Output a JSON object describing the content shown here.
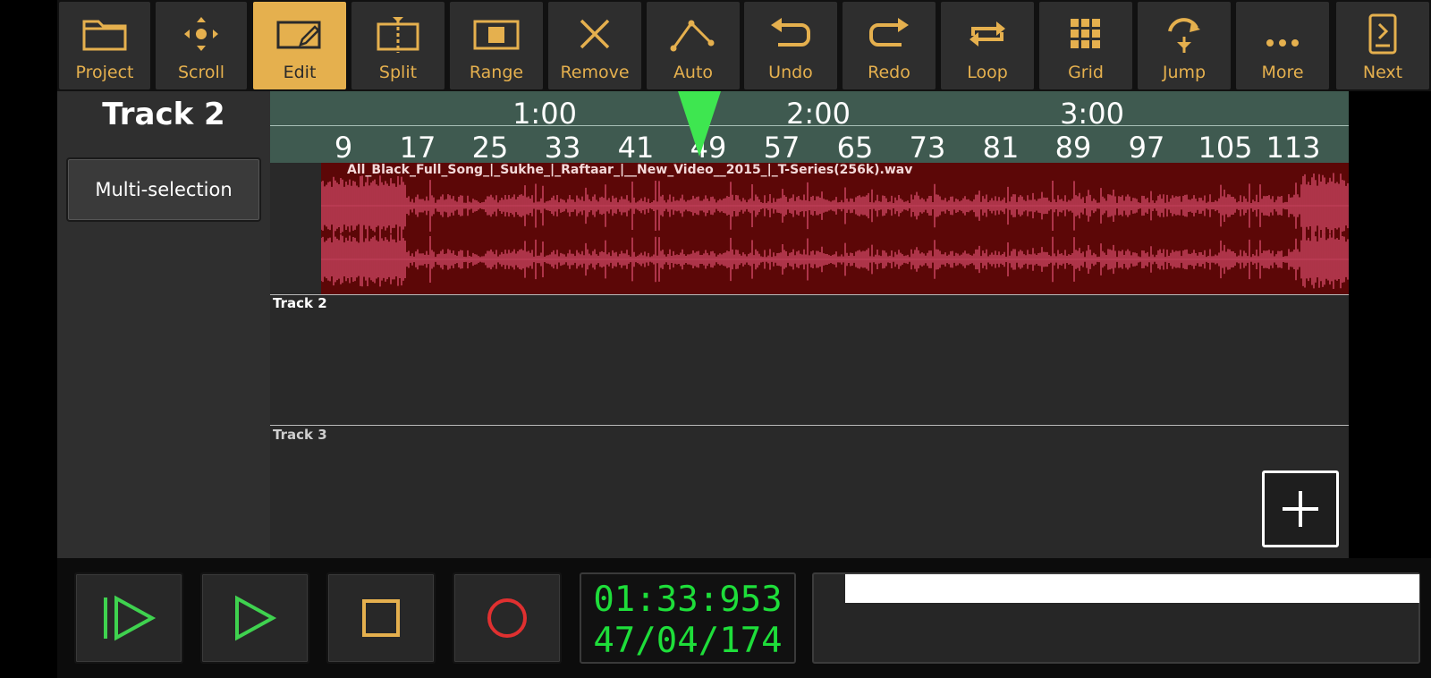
{
  "toolbar": {
    "project": "Project",
    "scroll": "Scroll",
    "edit": "Edit",
    "split": "Split",
    "range": "Range",
    "remove": "Remove",
    "auto": "Auto",
    "undo": "Undo",
    "redo": "Redo",
    "loop": "Loop",
    "grid": "Grid",
    "jump": "Jump",
    "more": "More",
    "next": "Next",
    "active": "Edit"
  },
  "track_panel": {
    "title": "Track 2",
    "multi_selection": "Multi-selection"
  },
  "ruler": {
    "times": [
      "1:00",
      "2:00",
      "3:00"
    ],
    "bars": [
      "9",
      "17",
      "25",
      "33",
      "41",
      "49",
      "57",
      "65",
      "73",
      "81",
      "89",
      "97",
      "105",
      "113"
    ]
  },
  "tracks": {
    "clip_name": "All_Black_Full_Song_|_Sukhe_|_Raftaar_|__New_Video__2015_|_T-Series(256k).wav",
    "track2": "Track 2",
    "track3": "Track 3"
  },
  "transport": {
    "time": "01:33:953",
    "position": "47/04/174"
  },
  "colors": {
    "accent": "#e5b04e",
    "ruler": "#3f5a50",
    "playhead": "#3ee650",
    "clip_bg": "#5c0707",
    "waveform": "#c2405a",
    "counter_text": "#1ede3a",
    "record": "#e03030",
    "stop": "#e5b04e",
    "play": "#3fd24f"
  },
  "icons": {
    "project": "folder-icon",
    "scroll": "move-arrows-icon",
    "edit": "pencil-box-icon",
    "split": "split-icon",
    "range": "range-icon",
    "remove": "x-icon",
    "auto": "automation-icon",
    "undo": "undo-icon",
    "redo": "redo-icon",
    "loop": "loop-icon",
    "grid": "grid-icon",
    "jump": "jump-icon",
    "more": "more-dots-icon",
    "next": "next-page-icon",
    "add_track": "plus-icon",
    "play_from_start": "play-from-start-icon",
    "play": "play-icon",
    "stop": "stop-icon",
    "record": "record-icon"
  }
}
